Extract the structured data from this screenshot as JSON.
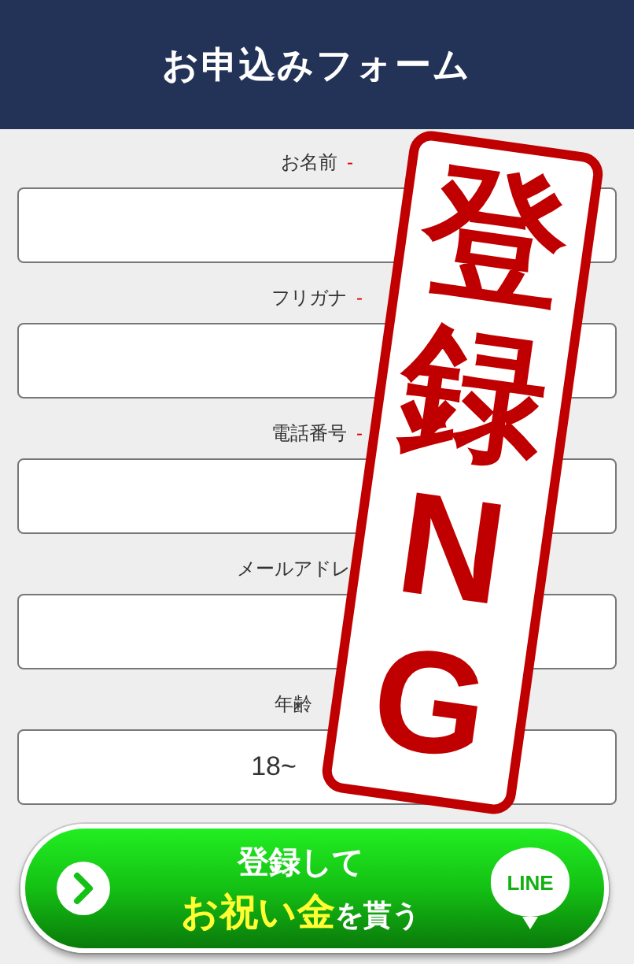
{
  "header": {
    "title": "お申込みフォーム"
  },
  "fields": [
    {
      "label": "お名前",
      "required": true,
      "kind": "text"
    },
    {
      "label": "フリガナ",
      "required": true,
      "kind": "text"
    },
    {
      "label": "電話番号",
      "required": true,
      "kind": "text"
    },
    {
      "label": "メールアドレ",
      "required": false,
      "kind": "text"
    },
    {
      "label": "年齢",
      "required": false,
      "kind": "select",
      "value": "18~"
    }
  ],
  "required_mark": "-",
  "submit_button": {
    "line1": "登録して",
    "line2_parts": [
      {
        "text": "お祝い金",
        "highlight": true
      },
      {
        "text": "を貰う",
        "highlight": false
      }
    ],
    "badge": "LINE"
  },
  "stamp": {
    "text": "登録NG"
  }
}
